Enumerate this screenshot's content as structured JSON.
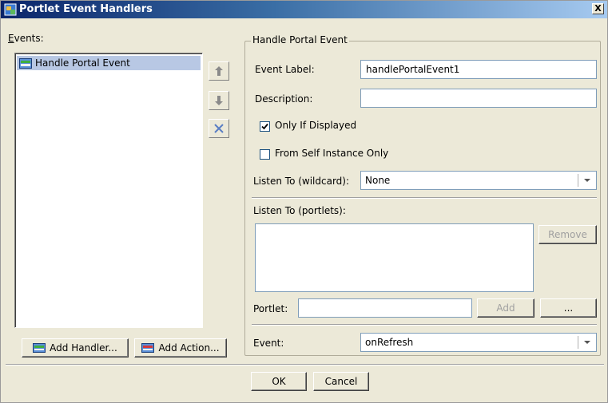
{
  "window": {
    "title": "Portlet Event Handlers",
    "close_label": "X"
  },
  "events": {
    "label": "Events:",
    "items": [
      {
        "label": "Handle Portal Event"
      }
    ],
    "add_handler_label": "Add Handler...",
    "add_action_label": "Add Action..."
  },
  "group": {
    "title": "Handle Portal Event",
    "event_label_label": "Event Label:",
    "event_label_value": "handlePortalEvent1",
    "description_label": "Description:",
    "description_value": "",
    "only_if_displayed_label": "Only If Displayed",
    "only_if_displayed_checked": true,
    "from_self_label": "From Self Instance Only",
    "from_self_checked": false,
    "listen_wildcard_label": "Listen To (wildcard):",
    "listen_wildcard_value": "None",
    "listen_portlets_label": "Listen To (portlets):",
    "remove_label": "Remove",
    "portlet_label": "Portlet:",
    "portlet_value": "",
    "add_label": "Add",
    "browse_label": "...",
    "event_label": "Event:",
    "event_value": "onRefresh"
  },
  "footer": {
    "ok_label": "OK",
    "cancel_label": "Cancel"
  },
  "icons": {
    "up": "up-arrow-icon",
    "down": "down-arrow-icon",
    "delete": "delete-x-icon"
  },
  "colors": {
    "title_start": "#0a246a",
    "title_end": "#a6caf0",
    "selection": "#b8c8e4",
    "face": "#ece9d8"
  }
}
